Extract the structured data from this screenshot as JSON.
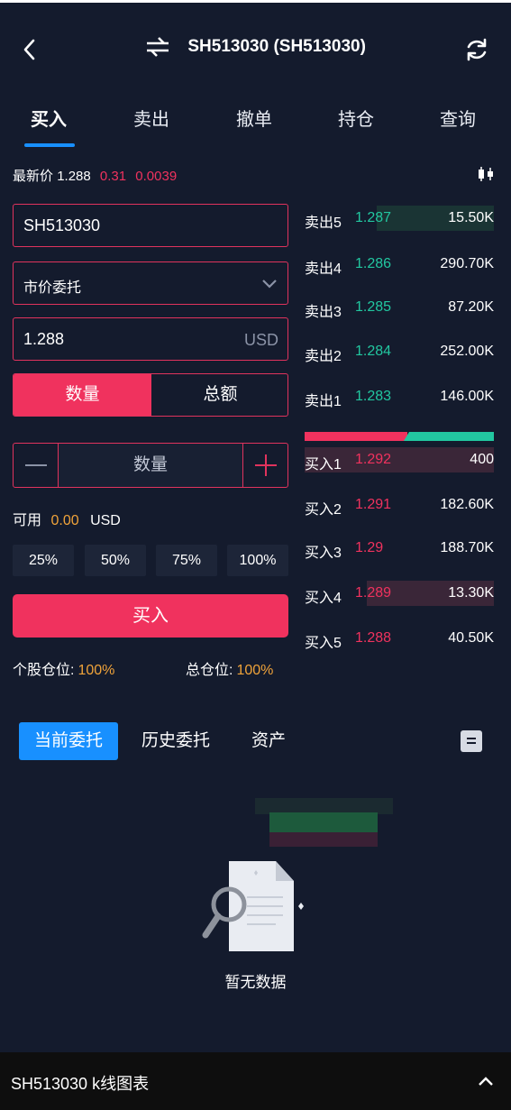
{
  "header": {
    "title": "SH513030 (SH513030)",
    "icons": [
      "back-arrow-icon",
      "swap-icon",
      "refresh-icon"
    ]
  },
  "tabs": [
    "买入",
    "卖出",
    "撤单",
    "持仓",
    "查询"
  ],
  "active_tab": "买入",
  "price": {
    "label": "最新价",
    "last": "1.288",
    "change_pct": "0.31",
    "change": "0.0039"
  },
  "form": {
    "symbol": "SH513030",
    "order_type": "市价委托",
    "price": "1.288",
    "price_unit": "USD",
    "mode_qty": "数量",
    "mode_amount": "总额",
    "qty_placeholder": "数量",
    "available_label": "可用",
    "available_amount": "0.00",
    "available_currency": "USD",
    "percent_options": [
      "25%",
      "50%",
      "75%",
      "100%"
    ],
    "buy_label": "买入",
    "single_pos_label": "个股仓位:",
    "single_pos_value": "100%",
    "total_pos_label": "总仓位:",
    "total_pos_value": "100%"
  },
  "orderbook": {
    "asks": [
      {
        "label": "卖出5",
        "price": "1.287",
        "volume": "15.50K"
      },
      {
        "label": "卖出4",
        "price": "1.286",
        "volume": "290.70K"
      },
      {
        "label": "卖出3",
        "price": "1.285",
        "volume": "87.20K"
      },
      {
        "label": "卖出2",
        "price": "1.284",
        "volume": "252.00K"
      },
      {
        "label": "卖出1",
        "price": "1.283",
        "volume": "146.00K"
      }
    ],
    "bids": [
      {
        "label": "买入1",
        "price": "1.292",
        "volume": "400"
      },
      {
        "label": "买入2",
        "price": "1.291",
        "volume": "182.60K"
      },
      {
        "label": "买入3",
        "price": "1.29",
        "volume": "188.70K"
      },
      {
        "label": "买入4",
        "price": "1.289",
        "volume": "13.30K"
      },
      {
        "label": "买入5",
        "price": "1.288",
        "volume": "40.50K"
      }
    ]
  },
  "bottom_tabs": [
    "当前委托",
    "历史委托",
    "资产"
  ],
  "empty_text": "暂无数据",
  "footer": {
    "label": "SH513030  k线图表"
  },
  "colors": {
    "red": "#f0325e",
    "green": "#22c7a0",
    "blue": "#1890ff",
    "orange": "#f0a33a",
    "bg": "#141b2d"
  }
}
